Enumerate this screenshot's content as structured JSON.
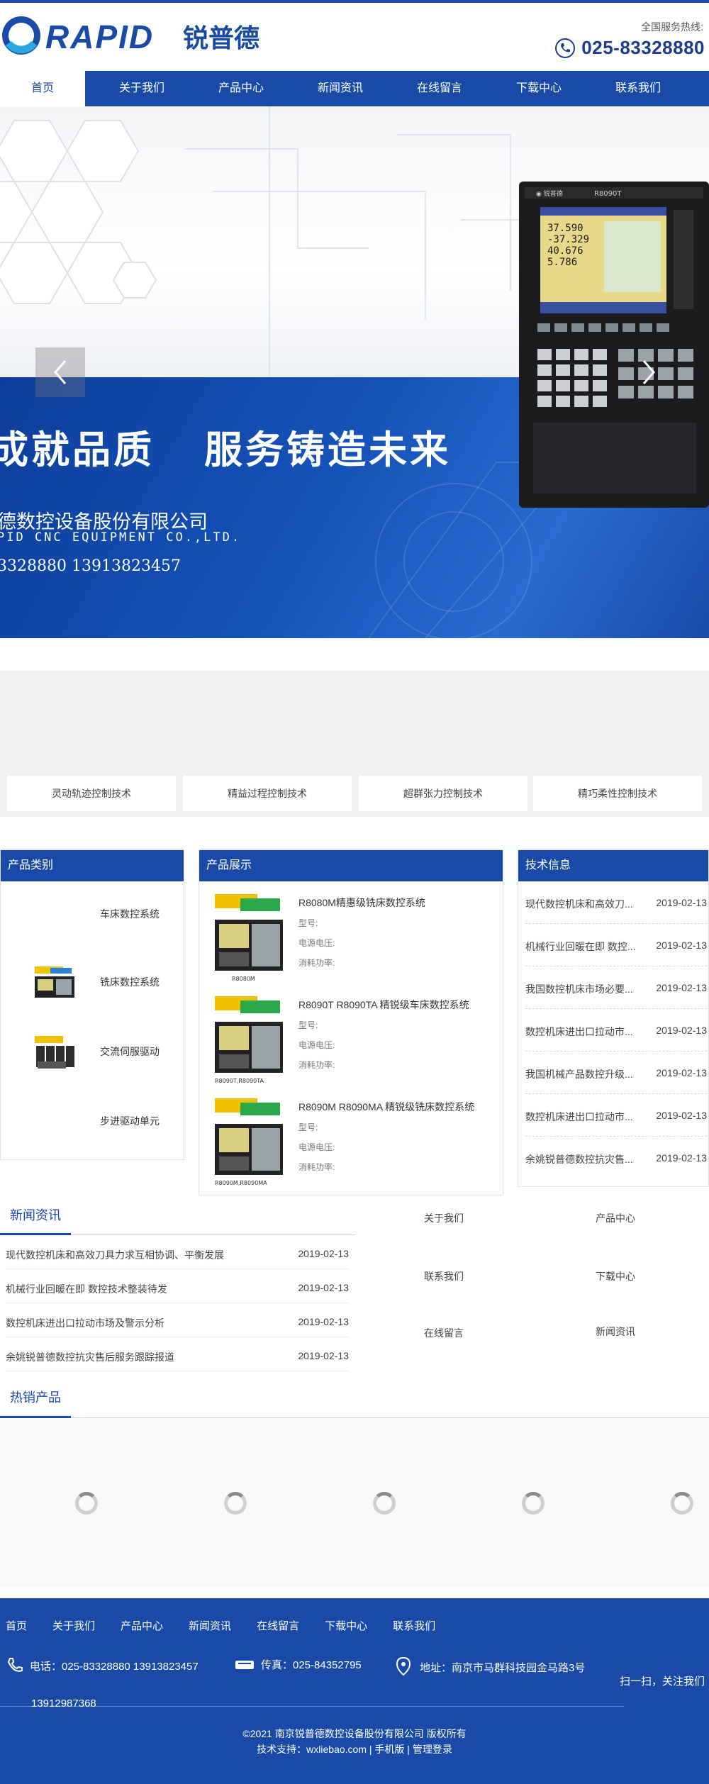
{
  "header": {
    "brand": "RAPID",
    "brand_cn": "锐普德",
    "hotline_label": "全国服务热线:",
    "hotline": "025-83328880"
  },
  "nav": [
    "首页",
    "关于我们",
    "产品中心",
    "新闻资讯",
    "在线留言",
    "下载中心",
    "联系我们"
  ],
  "banner": {
    "slogan_left": "成就品质",
    "slogan_right": "服务铸造未来",
    "company_cn": "德数控设备股份有限公司",
    "company_en": "PID CNC EQUIPMENT CO.,LTD.",
    "phones": "3328880  13913823457",
    "device_label": "R8090T",
    "screen_values": [
      "37.590",
      "-37.329",
      "40.676",
      "5.786"
    ]
  },
  "tech_buttons": [
    "灵动轨迹控制技术",
    "精益过程控制技术",
    "超群张力控制技术",
    "精巧柔性控制技术"
  ],
  "categories": {
    "title": "产品类别",
    "items": [
      "车床数控系统",
      "铣床数控系统",
      "交流伺服驱动",
      "步进驱动单元"
    ]
  },
  "products": {
    "title": "产品展示",
    "spec_labels": [
      "型号:",
      "电源电压:",
      "消耗功率:"
    ],
    "items": [
      {
        "name": "R8080M精惠级铣床数控系统",
        "caption": "R8080M"
      },
      {
        "name": "R8090T R8090TA 精锐级车床数控系统",
        "caption": "R8090T,R8090TA"
      },
      {
        "name": "R8090M R8090MA 精锐级铣床数控系统",
        "caption": "R8090M,R8090MA"
      }
    ]
  },
  "tech_info": {
    "title": "技术信息",
    "rows": [
      {
        "title": "现代数控机床和高效刀...",
        "date": "2019-02-13"
      },
      {
        "title": "机械行业回暖在即 数控...",
        "date": "2019-02-13"
      },
      {
        "title": "我国数控机床市场必要...",
        "date": "2019-02-13"
      },
      {
        "title": "数控机床进出口拉动市...",
        "date": "2019-02-13"
      },
      {
        "title": "我国机械产品数控升级...",
        "date": "2019-02-13"
      },
      {
        "title": "数控机床进出口拉动市...",
        "date": "2019-02-13"
      },
      {
        "title": "余姚锐普德数控抗灾售...",
        "date": "2019-02-13"
      }
    ]
  },
  "news": {
    "title": "新闻资讯",
    "rows": [
      {
        "title": "现代数控机床和高效刀具力求互相协调、平衡发展",
        "date": "2019-02-13"
      },
      {
        "title": "机械行业回暖在即 数控技术整装待发",
        "date": "2019-02-13"
      },
      {
        "title": "数控机床进出口拉动市场及警示分析",
        "date": "2019-02-13"
      },
      {
        "title": "余姚锐普德数控抗灾售后服务跟踪报道",
        "date": "2019-02-13"
      }
    ]
  },
  "quick_links": [
    "关于我们",
    "产品中心",
    "联系我们",
    "下载中心",
    "在线留言",
    "新闻资讯"
  ],
  "hot": {
    "title": "热销产品"
  },
  "footer": {
    "nav": [
      "首页",
      "关于我们",
      "产品中心",
      "新闻资讯",
      "在线留言",
      "下载中心",
      "联系我们"
    ],
    "phone": "电话：025-83328880 13913823457",
    "phone2": "13912987368",
    "fax": "传真：025-84352795",
    "address": "地址：南京市马群科技园金马路3号",
    "qr_text": "扫一扫，关注我们",
    "copyright": "©2021 南京锐普德数控设备股份有限公司 版权所有",
    "support": "技术支持：wxliebao.com | 手机版 | 管理登录"
  },
  "colors": {
    "brand_blue": "#1a4aa8",
    "dark_blue": "#1a3c8c"
  }
}
